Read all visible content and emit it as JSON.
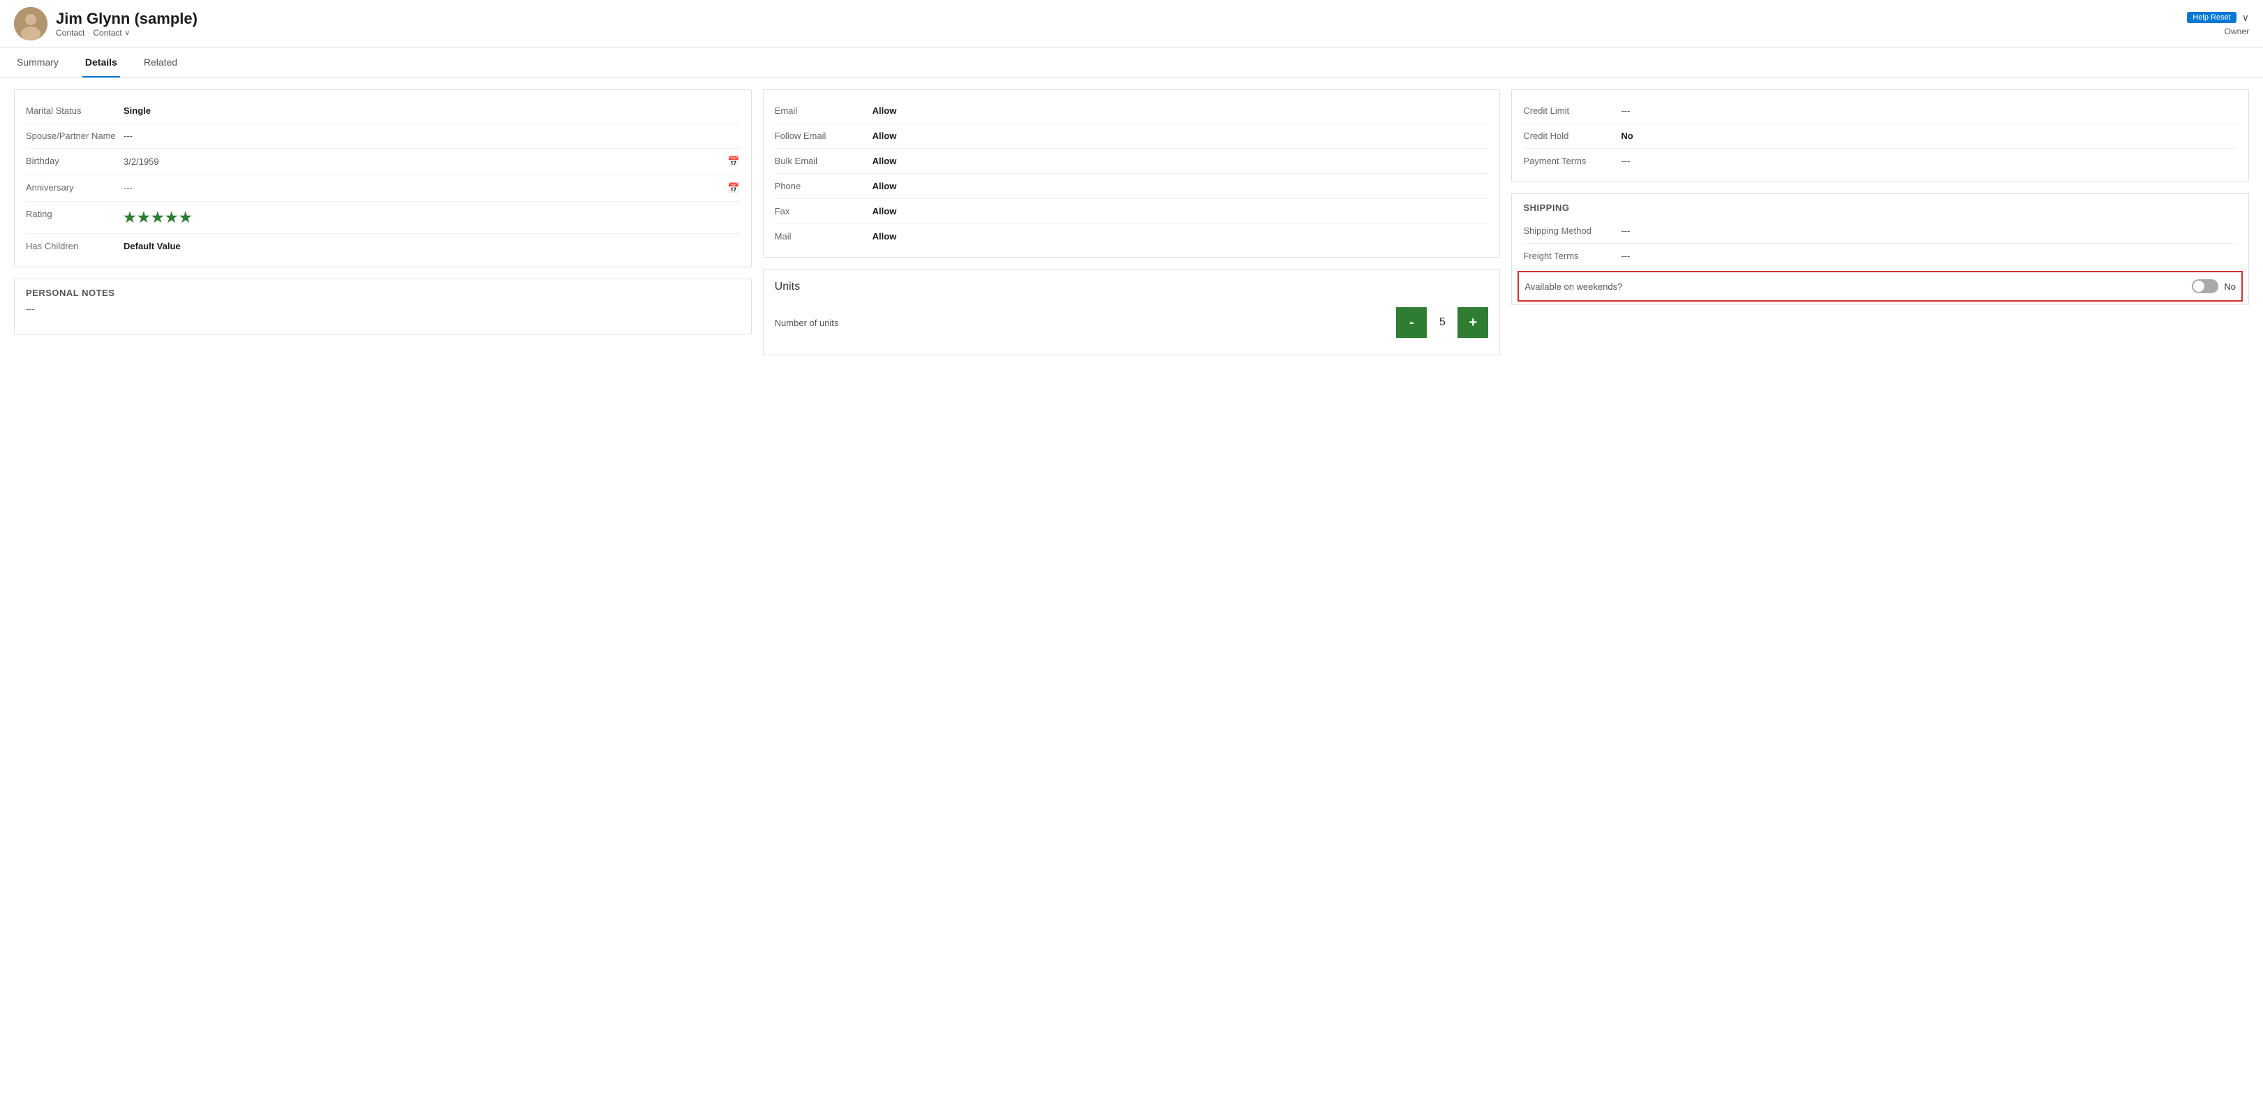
{
  "header": {
    "name": "Jim Glynn (sample)",
    "type1": "Contact",
    "dot": "·",
    "type2": "Contact",
    "chevron": "∨",
    "badge": "Help Reset",
    "owner_label": "Owner",
    "expand_icon": "∨"
  },
  "tabs": [
    {
      "id": "summary",
      "label": "Summary",
      "active": false
    },
    {
      "id": "details",
      "label": "Details",
      "active": true
    },
    {
      "id": "related",
      "label": "Related",
      "active": false
    }
  ],
  "personal_info": {
    "fields": [
      {
        "label": "Marital Status",
        "value": "Single",
        "bold": true
      },
      {
        "label": "Spouse/Partner Name",
        "value": "---",
        "bold": false
      },
      {
        "label": "Birthday",
        "value": "3/2/1959",
        "bold": false,
        "calendar": true
      },
      {
        "label": "Anniversary",
        "value": "---",
        "bold": false,
        "calendar": true
      },
      {
        "label": "Rating",
        "value": "★★★★★",
        "stars": true
      },
      {
        "label": "Has Children",
        "value": "Default Value",
        "bold": true
      }
    ]
  },
  "contact_preferences": {
    "fields": [
      {
        "label": "Email",
        "value": "Allow",
        "bold": true
      },
      {
        "label": "Follow Email",
        "value": "Allow",
        "bold": true
      },
      {
        "label": "Bulk Email",
        "value": "Allow",
        "bold": true
      },
      {
        "label": "Phone",
        "value": "Allow",
        "bold": true
      },
      {
        "label": "Fax",
        "value": "Allow",
        "bold": true
      },
      {
        "label": "Mail",
        "value": "Allow",
        "bold": true
      }
    ]
  },
  "billing": {
    "fields": [
      {
        "label": "Credit Limit",
        "value": "---"
      },
      {
        "label": "Credit Hold",
        "value": "No",
        "bold": true
      },
      {
        "label": "Payment Terms",
        "value": "---"
      }
    ]
  },
  "personal_notes": {
    "title": "PERSONAL NOTES",
    "value": "---"
  },
  "units": {
    "title": "Units",
    "number_of_units_label": "Number of units",
    "value": "5",
    "minus_label": "-",
    "plus_label": "+"
  },
  "shipping": {
    "title": "SHIPPING",
    "fields": [
      {
        "label": "Shipping Method",
        "value": "---"
      },
      {
        "label": "Freight Terms",
        "value": "---"
      }
    ],
    "available_weekends_label": "Available on weekends?",
    "available_weekends_value": "No",
    "toggle_on": false
  },
  "icons": {
    "calendar": "📅",
    "star_filled": "★",
    "chevron_down": "∨"
  }
}
